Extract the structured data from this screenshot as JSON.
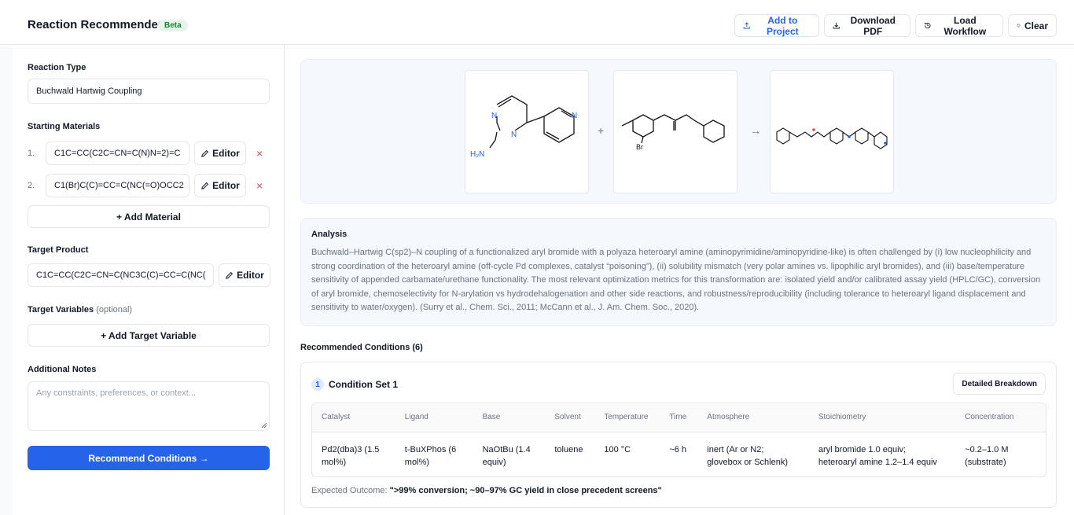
{
  "header": {
    "title": "Reaction Recommender",
    "badge": "Beta",
    "buttons": {
      "add_to_project": "Add to Project",
      "download_pdf": "Download PDF",
      "load_workflow": "Load Workflow",
      "clear": "Clear"
    }
  },
  "sidebar": {
    "reaction_type": {
      "label": "Reaction Type",
      "value": "Buchwald Hartwig Coupling"
    },
    "starting_materials": {
      "label": "Starting Materials",
      "items": [
        {
          "index": "1.",
          "smiles": "C1C=CC(C2C=CN=C(N)N=2)=C",
          "editor": "Editor",
          "remove": "×"
        },
        {
          "index": "2.",
          "smiles": "C1(Br)C(C)=CC=C(NC(=O)OCC2",
          "editor": "Editor",
          "remove": "×"
        }
      ],
      "add_label": "+ Add Material"
    },
    "target_product": {
      "label": "Target Product",
      "smiles": "C1C=CC(C2C=CN=C(NC3C(C)=CC=C(NC(",
      "editor": "Editor"
    },
    "target_variables": {
      "label": "Target Variables",
      "optional": "(optional)",
      "add_label": "+ Add Target Variable"
    },
    "additional_notes": {
      "label": "Additional Notes",
      "placeholder": "Any constraints, preferences, or context..."
    },
    "recommend_label": "Recommend Conditions →"
  },
  "reaction": {
    "plus": "+",
    "arrow": "→",
    "atom_labels": {
      "n": "N",
      "h2n": "H₂N",
      "br": "Br"
    }
  },
  "analysis": {
    "title": "Analysis",
    "text": "Buchwald–Hartwig C(sp2)–N coupling of a functionalized aryl bromide with a polyaza heteroaryl amine (aminopyrimidine/aminopyridine-like) is often challenged by (i) low nucleophilicity and strong coordination of the heteroaryl amine (off-cycle Pd complexes, catalyst “poisoning”), (ii) solubility mismatch (very polar amines vs. lipophilic aryl bromides), and (iii) base/temperature sensitivity of appended carbamate/urethane functionality. The most relevant optimization metrics for this transformation are: isolated yield and/or calibrated assay yield (HPLC/GC), conversion of aryl bromide, chemoselectivity for N-arylation vs hydrodehalogenation and other side reactions, and robustness/reproducibility (including tolerance to heteroaryl ligand displacement and sensitivity to water/oxygen). (Surry et al., Chem. Sci., 2011; McCann et al., J. Am. Chem. Soc., 2020)."
  },
  "recommended": {
    "title": "Recommended Conditions (6)",
    "condition": {
      "number": "1",
      "name": "Condition Set 1",
      "breakdown_label": "Detailed Breakdown",
      "columns": [
        "Catalyst",
        "Ligand",
        "Base",
        "Solvent",
        "Temperature",
        "Time",
        "Atmosphere",
        "Stoichiometry",
        "Concentration"
      ],
      "row": [
        "Pd2(dba)3 (1.5 mol%)",
        "t-BuXPhos (6 mol%)",
        "NaOtBu (1.4 equiv)",
        "toluene",
        "100 °C",
        "~6 h",
        "inert (Ar or N2; glovebox or Schlenk)",
        "aryl bromide 1.0 equiv; heteroaryl amine 1.2–1.4 equiv",
        "~0.2–1.0 M (substrate)"
      ],
      "outcome_label": "Expected Outcome:",
      "outcome_value": "\">99% conversion; ~90–97% GC yield in close precedent screens\""
    }
  },
  "colors": {
    "accent": "#2563eb",
    "beta_bg": "#e3f6e8",
    "beta_fg": "#17803d",
    "danger": "#ef4444"
  },
  "icons": [
    "upload-icon",
    "download-icon",
    "history-icon",
    "refresh-icon",
    "pencil-icon",
    "close-icon",
    "resize-handle-icon"
  ]
}
